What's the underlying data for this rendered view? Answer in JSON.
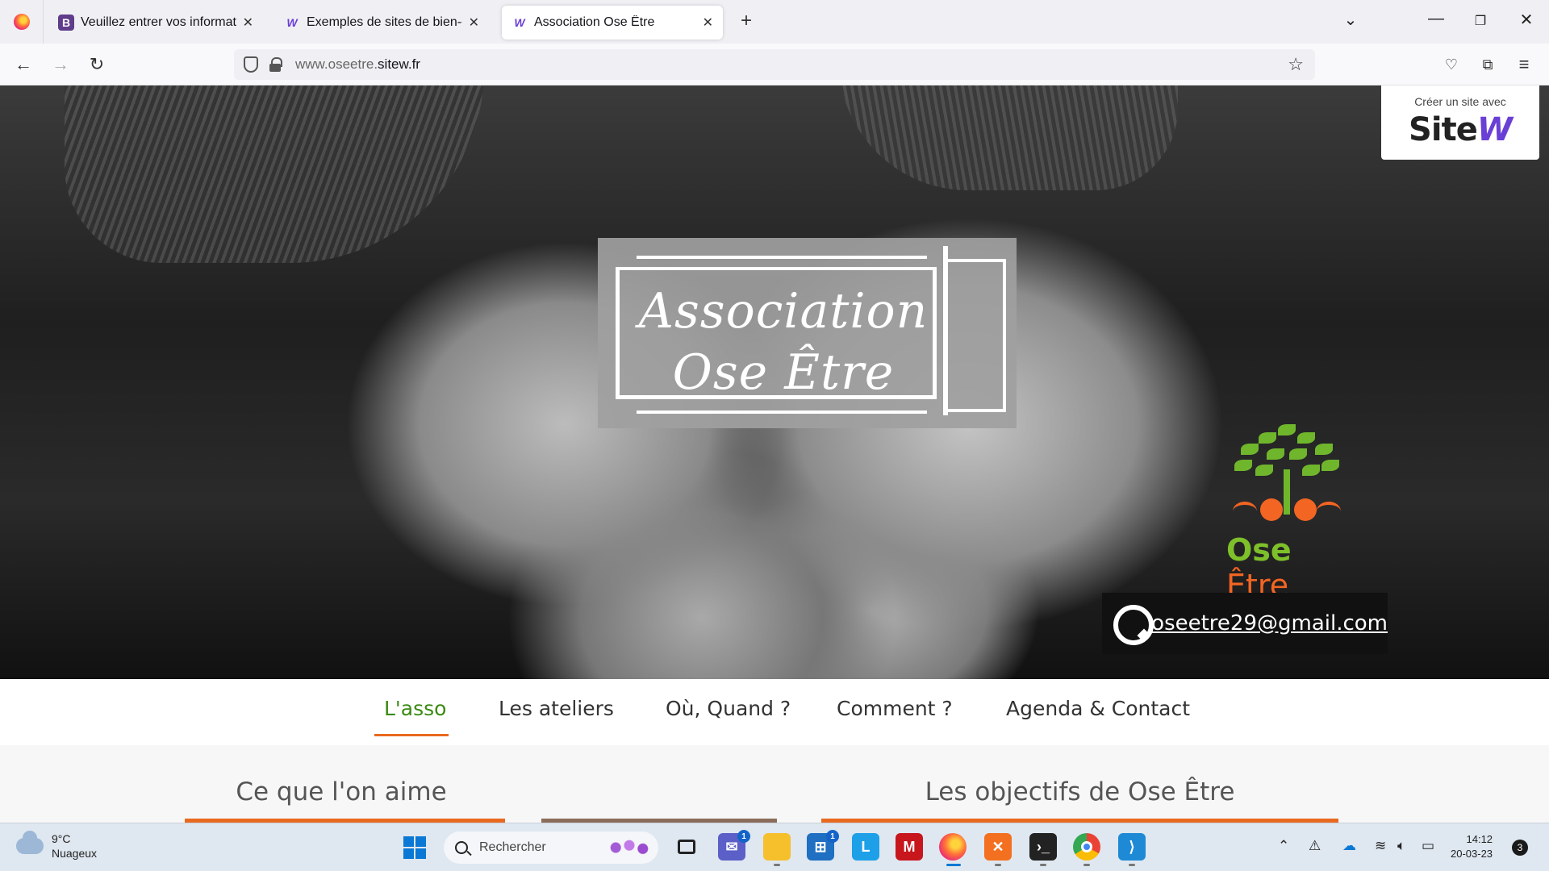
{
  "browser": {
    "tabs": [
      {
        "title": "Veuillez entrer vos informations",
        "favicon": "B",
        "active": false
      },
      {
        "title": "Exemples de sites de bien-être",
        "favicon": "W",
        "active": false
      },
      {
        "title": "Association Ose Être",
        "favicon": "W",
        "active": true
      }
    ],
    "url_prefix": "www.oseetre.",
    "url_domain": "sitew.fr"
  },
  "hero": {
    "sitew_badge_caption": "Créer un site avec",
    "sitew_badge_logo_main": "Site",
    "sitew_badge_logo_accent": "W",
    "title_line1": "Association",
    "title_line2": "Ose Être",
    "brand_green": "Ose",
    "brand_orange": "Être",
    "email": "oseetre29@gmail.com"
  },
  "menu": {
    "items": [
      "L'asso",
      "Les ateliers",
      "Où, Quand ?",
      "Comment ?",
      "Agenda & Contact"
    ],
    "active_index": 0
  },
  "content": {
    "section_left_title": "Ce que l'on aime",
    "section_right_title": "Les objectifs de Ose Être"
  },
  "taskbar": {
    "weather_temp": "9°C",
    "weather_desc": "Nuageux",
    "search_placeholder": "Rechercher",
    "teams_badge": "1",
    "store_badge": "1",
    "time": "14:12",
    "date": "20-03-23",
    "notification_count": "3"
  },
  "colors": {
    "accent_orange": "#e8691f",
    "menu_active_green": "#3a8a12",
    "brand_green": "#7ec02a",
    "sitew_purple": "#6a3fd6"
  }
}
